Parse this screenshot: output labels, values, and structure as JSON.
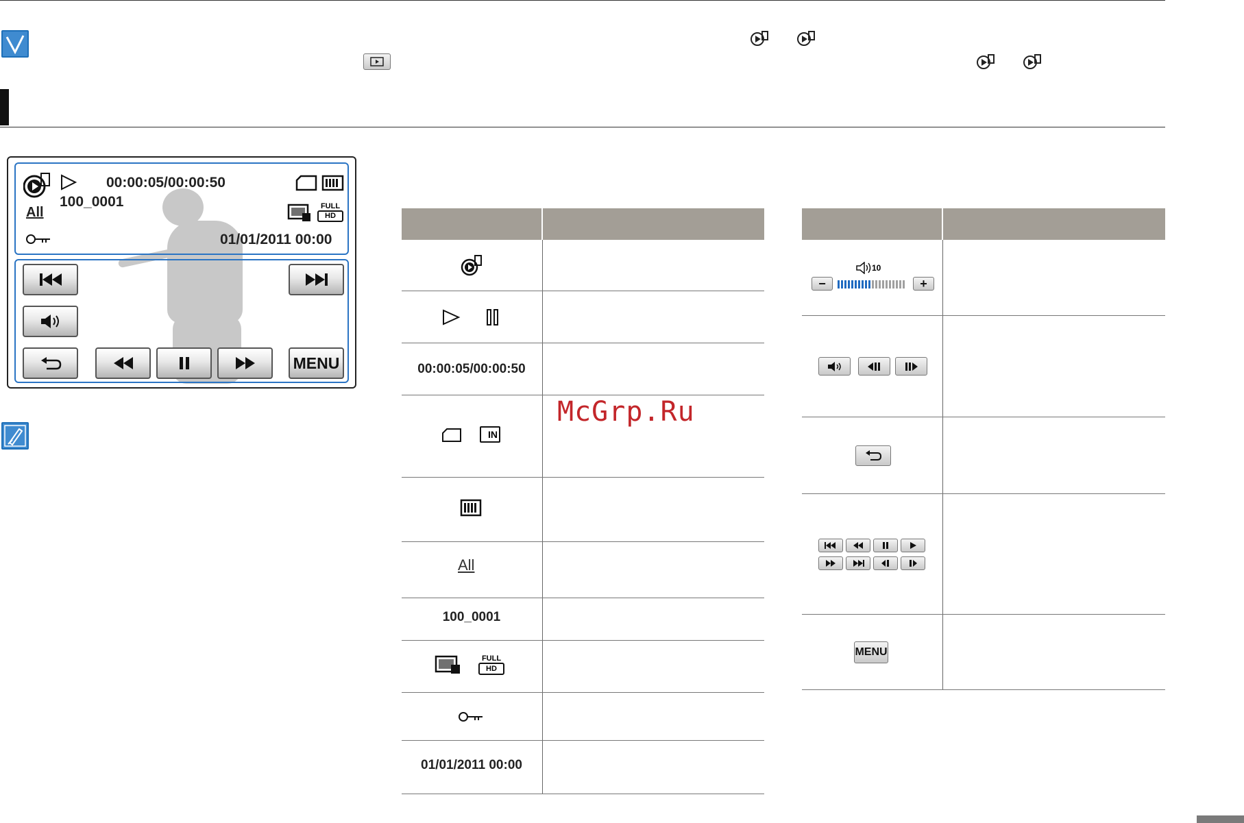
{
  "lcd": {
    "timecode": "00:00:05/00:00:50",
    "file_number": "100_0001",
    "datetime": "01/01/2011 00:00",
    "play_mode": "All",
    "resolution_top": "FULL",
    "resolution_bottom": "HD",
    "menu_label": "MENU"
  },
  "left_table": {
    "rows": [
      {
        "icon": "movie-playback-mode-icon"
      },
      {
        "icon": "play-pause-icon"
      },
      {
        "text": "00:00:05/00:00:50"
      },
      {
        "icon": "storage-media-icon",
        "badge": "IN"
      },
      {
        "icon": "battery-icon"
      },
      {
        "icon": "play-option-icon",
        "text": "All"
      },
      {
        "text": "100_0001"
      },
      {
        "icon": "quality-resolution-icon",
        "res_top": "FULL",
        "res_bottom": "HD"
      },
      {
        "icon": "protect-key-icon"
      },
      {
        "text": "01/01/2011 00:00"
      }
    ]
  },
  "right_table": {
    "volume_value": "10",
    "menu_label": "MENU"
  },
  "watermark": "McGrp.Ru",
  "colors": {
    "accent_blue": "#2a74c4",
    "header_gray": "#a39e96",
    "watermark_red": "#c3262a"
  }
}
